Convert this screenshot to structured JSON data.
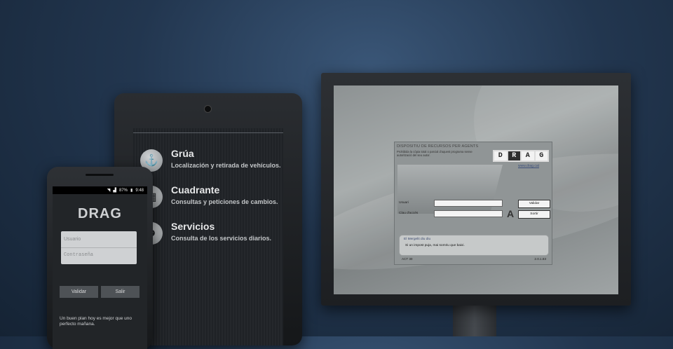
{
  "monitor": {
    "dialog": {
      "title": "DISPOSITIU DE RECURSOS PER AGENTS",
      "subtitle": "Prohibida la còpia total o parcial d'aquest programa sense autorització del seu autor.",
      "logo_letters": [
        "D",
        "R",
        "A",
        "G"
      ],
      "logo_url": "www.drag.cat",
      "user_label": "Usuari",
      "password_label": "Clau d'accés",
      "validate_button": "Validar",
      "exit_button": "Sortir",
      "message_title": "El Mergelit diu diu",
      "message_text": "Si un impost puja, mai somriu que baixi.",
      "footer_left": "ACT 30",
      "footer_right": "2.0.1.83"
    }
  },
  "tablet": {
    "items": [
      {
        "title": "Grúa",
        "subtitle": "Localización y retirada de vehículos.",
        "icon": "hook-icon"
      },
      {
        "title": "Cuadrante",
        "subtitle": "Consultas y peticiones de cambios.",
        "icon": "calendar-icon"
      },
      {
        "title": "Servicios",
        "subtitle": "Consulta de los servicios diarios.",
        "icon": "officer-icon"
      }
    ]
  },
  "phone": {
    "status": {
      "battery": "87%",
      "time": "9:48"
    },
    "app_title": "DRAG",
    "username_placeholder": "Usuario",
    "password_placeholder": "Contraseña",
    "validate_button": "Validar",
    "exit_button": "Salir",
    "footer_text": "Un buen plan hoy es mejor que uno perfecto mañana."
  }
}
